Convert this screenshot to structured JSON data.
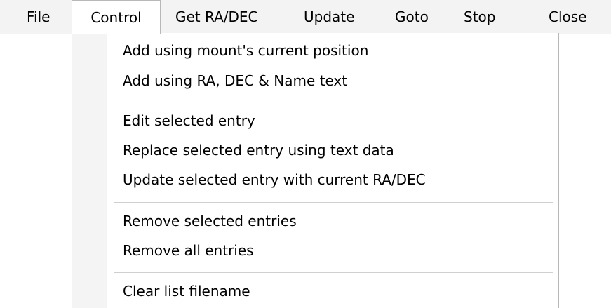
{
  "menubar": {
    "items": [
      {
        "label": "File"
      },
      {
        "label": "Control"
      },
      {
        "label": "Get RA/DEC"
      },
      {
        "label": "Update"
      },
      {
        "label": "Goto"
      },
      {
        "label": "Stop"
      },
      {
        "label": "Close"
      }
    ]
  },
  "control_menu": {
    "items": [
      {
        "label": "Add using mount's current position"
      },
      {
        "label": "Add using RA, DEC & Name text"
      },
      {
        "label": "Edit selected entry"
      },
      {
        "label": "Replace selected entry using text data"
      },
      {
        "label": "Update selected entry with current RA/DEC"
      },
      {
        "label": "Remove selected entries"
      },
      {
        "label": "Remove all entries"
      },
      {
        "label": "Clear list filename"
      }
    ]
  }
}
